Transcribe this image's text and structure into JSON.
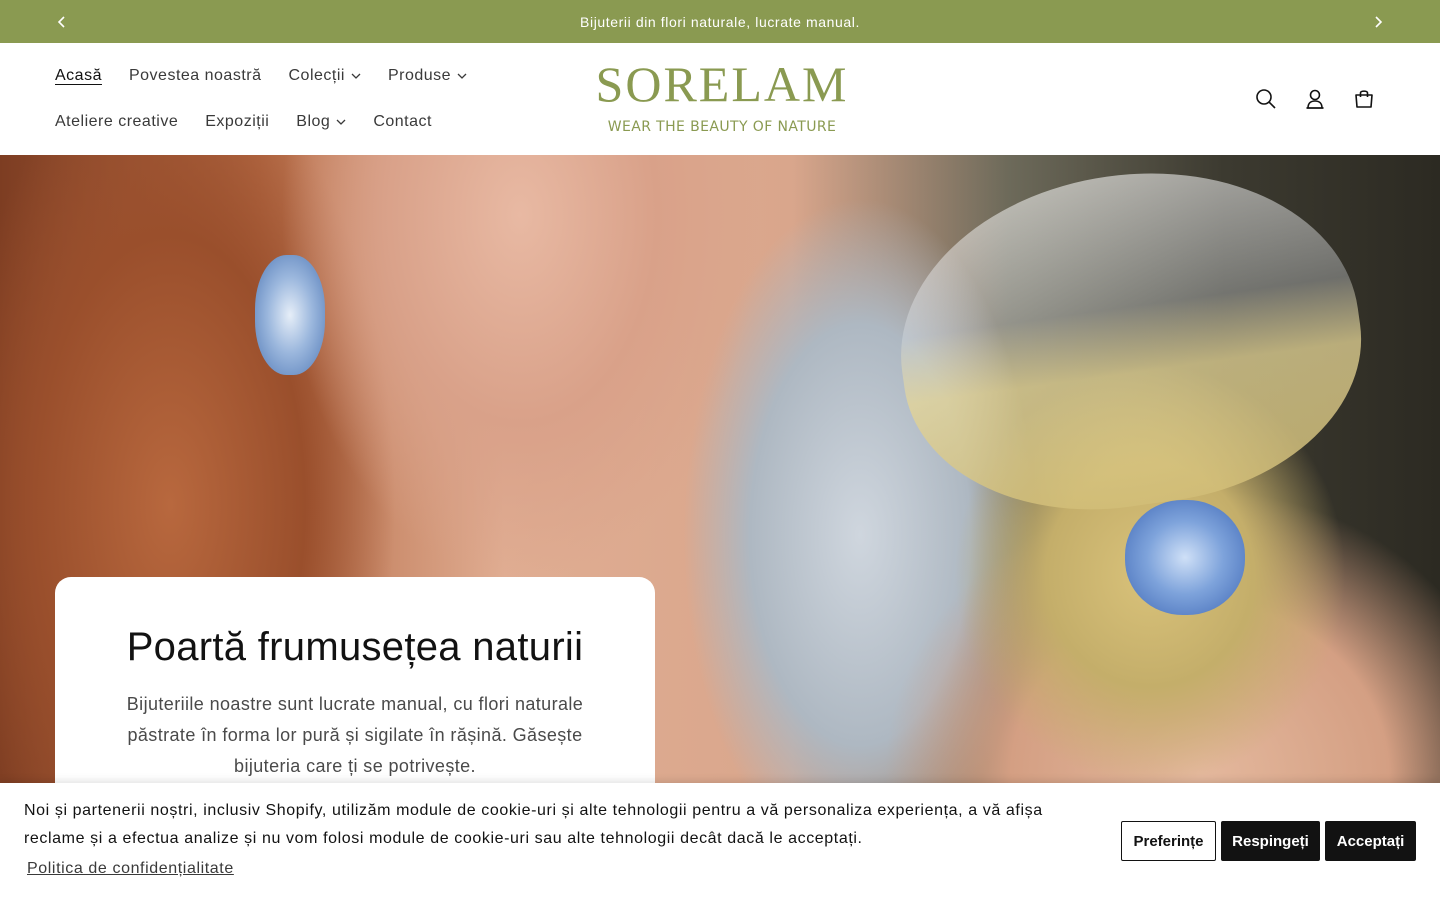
{
  "announcement": {
    "text": "Bijuterii din flori naturale, lucrate manual."
  },
  "nav": {
    "row1": [
      {
        "label": "Acasă",
        "dropdown": false,
        "active": true
      },
      {
        "label": "Povestea noastră",
        "dropdown": false
      },
      {
        "label": "Colecții",
        "dropdown": true
      },
      {
        "label": "Produse",
        "dropdown": true
      }
    ],
    "row2": [
      {
        "label": "Ateliere creative",
        "dropdown": false
      },
      {
        "label": "Expoziții",
        "dropdown": false
      },
      {
        "label": "Blog",
        "dropdown": true
      },
      {
        "label": "Contact",
        "dropdown": false
      }
    ]
  },
  "logo": {
    "name": "SORELAM",
    "tagline": "WEAR THE BEAUTY OF NATURE"
  },
  "header_icons": [
    "search-icon",
    "account-icon",
    "cart-icon"
  ],
  "hero": {
    "title": "Poartă frumusețea naturii",
    "text": "Bijuteriile noastre sunt lucrate manual, cu flori naturale păstrate în forma lor pură și sigilate în rășină. Găsește bijuteria care ți se potrivește."
  },
  "cookie": {
    "message": "Noi și partenerii noștri, inclusiv Shopify, utilizăm module de cookie-uri și alte tehnologii pentru a vă personaliza experiența, a vă afișa reclame și a efectua analize și nu vom folosi module de cookie-uri sau alte tehnologii decât dacă le acceptați.",
    "policy_link": "Politica de confidențialitate",
    "preferences": "Preferințe",
    "reject": "Respingeți",
    "accept": "Acceptați"
  },
  "colors": {
    "brand_green": "#8a9a51",
    "button_dark": "#121212"
  }
}
